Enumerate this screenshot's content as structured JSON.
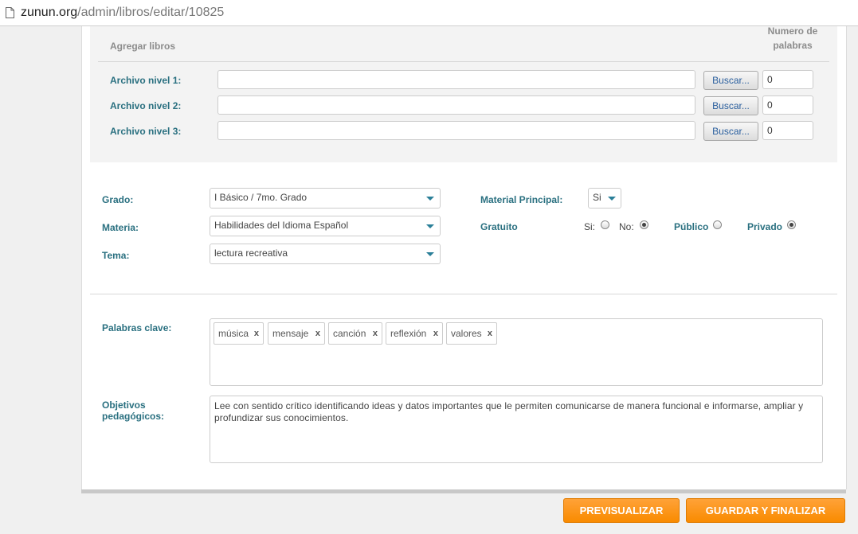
{
  "browser": {
    "url_domain": "zunun.org",
    "url_path": "/admin/libros/editar/10825"
  },
  "files": {
    "heading": "Agregar libros",
    "words_heading_line1": "Numero de",
    "words_heading_line2": "palabras",
    "rows": [
      {
        "label": "Archivo nivel 1:",
        "button": "Buscar...",
        "count": "0"
      },
      {
        "label": "Archivo nivel 2:",
        "button": "Buscar...",
        "count": "0"
      },
      {
        "label": "Archivo nivel 3:",
        "button": "Buscar...",
        "count": "0"
      }
    ]
  },
  "form": {
    "grado": {
      "label": "Grado:",
      "value": "I Básico / 7mo. Grado"
    },
    "materia": {
      "label": "Materia:",
      "value": "Habilidades del Idioma Español"
    },
    "tema": {
      "label": "Tema:",
      "value": "lectura recreativa"
    },
    "material_principal": {
      "label": "Material Principal:",
      "value": "Si"
    },
    "gratuito": {
      "label": "Gratuito",
      "si": "Si:",
      "no": "No:",
      "selected": "No"
    },
    "visibility": {
      "publico": "Público",
      "privado": "Privado",
      "selected": "Privado"
    }
  },
  "keywords": {
    "label": "Palabras clave:",
    "remove_symbol": "x",
    "tags": [
      "música",
      "mensaje",
      "canción",
      "reflexión",
      "valores"
    ]
  },
  "objectives": {
    "label_line1": "Objetivos",
    "label_line2": "pedagógicos:",
    "text": "Lee con sentido crítico identificando ideas y datos importantes que le permiten comunicarse de manera funcional e informarse, ampliar y profundizar sus conocimientos."
  },
  "actions": {
    "preview": "PREVISUALIZAR",
    "save": "GUARDAR Y FINALIZAR"
  },
  "colors": {
    "label_teal": "#2a7080",
    "button_orange": "#f98b00"
  }
}
